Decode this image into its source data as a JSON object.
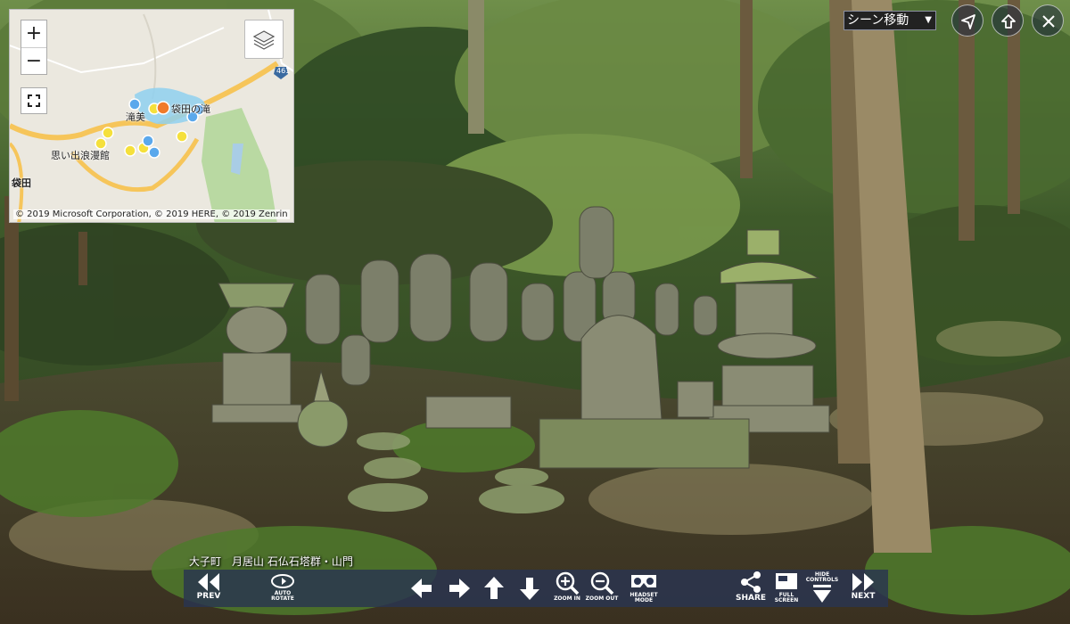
{
  "map": {
    "zoom_in_label": "+",
    "zoom_out_label": "−",
    "copyright": "© 2019 Microsoft Corporation, © 2019 HERE, © 2019 Zenrin",
    "labels": {
      "place1": "滝美",
      "place2": "袋田の滝",
      "place3": "思い出浪漫館",
      "place4": "袋田",
      "route": "461"
    },
    "colors": {
      "current_marker": "#f07a2a",
      "visited_marker": "#f5e03c",
      "other_marker": "#5aa8ec",
      "area": "#8fd0f0"
    }
  },
  "scene_select": {
    "value": "シーン移動",
    "arrow": "▼"
  },
  "top_buttons": [
    {
      "icon": "navigate-icon"
    },
    {
      "icon": "upload-icon"
    },
    {
      "icon": "close-icon"
    }
  ],
  "caption": "大子町　月居山 石仏石塔群・山門",
  "toolbar": {
    "prev": "PREV",
    "auto_rotate_1": "AUTO",
    "auto_rotate_2": "ROTATE",
    "zoom_in": "ZOOM IN",
    "zoom_out": "ZOOM OUT",
    "headset_1": "HEADSET",
    "headset_2": "MODE",
    "share": "SHARE",
    "full_1": "FULL",
    "full_2": "SCREEN",
    "hide_1": "HIDE",
    "hide_2": "CONTROLS",
    "next": "NEXT"
  }
}
